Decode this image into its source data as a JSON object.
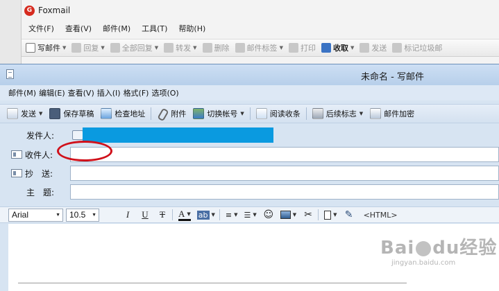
{
  "main_window": {
    "app_name": "Foxmail",
    "logo_letter": "G",
    "menu": [
      "文件(F)",
      "查看(V)",
      "邮件(M)",
      "工具(T)",
      "帮助(H)"
    ],
    "toolbar": [
      {
        "label": "写邮件",
        "icon": "compose-icon"
      },
      {
        "label": "回复",
        "icon": "reply-icon"
      },
      {
        "label": "全部回复",
        "icon": "reply-all-icon"
      },
      {
        "label": "转发",
        "icon": "forward-icon"
      },
      {
        "label": "删除",
        "icon": "delete-icon"
      },
      {
        "label": "邮件标签",
        "icon": "tag-icon"
      },
      {
        "label": "打印",
        "icon": "print-icon"
      },
      {
        "label": "收取",
        "icon": "receive-icon"
      },
      {
        "label": "发送",
        "icon": "send-icon"
      },
      {
        "label": "标记垃圾邮",
        "icon": "spam-icon"
      }
    ]
  },
  "compose": {
    "title": "未命名 - 写邮件",
    "menu": [
      "邮件(M)",
      "编辑(E)",
      "查看(V)",
      "插入(I)",
      "格式(F)",
      "选项(O)"
    ],
    "toolbar": {
      "send": "发送",
      "save_draft": "保存草稿",
      "check_address": "检查地址",
      "attach": "附件",
      "switch_account": "切换帐号",
      "read_receipt": "阅读收条",
      "follow_up": "后续标志",
      "encrypt": "邮件加密"
    },
    "fields": {
      "from_label": "发件人:",
      "to_label": "收件人:",
      "cc_label": "抄　送:",
      "subject_label": "主　题:",
      "from_value": "",
      "to_value": "",
      "cc_value": "",
      "subject_value": ""
    },
    "format_bar": {
      "font": "Arial",
      "size": "10.5",
      "italic": "I",
      "underline": "U",
      "strike": "T",
      "font_color": "A",
      "highlight": "ab",
      "align": "≡",
      "list": "☰",
      "emoji": "☺",
      "html": "<HTML>"
    },
    "body_text": ""
  },
  "watermark": {
    "brand": "Bai",
    "brand_mid": "du",
    "brand_end": "经验",
    "url": "jingyan.baidu.com"
  },
  "colors": {
    "highlight_ellipse": "#d0101a",
    "sender_fill": "#0a9ae0",
    "title_gradient_top": "#cddff4"
  }
}
